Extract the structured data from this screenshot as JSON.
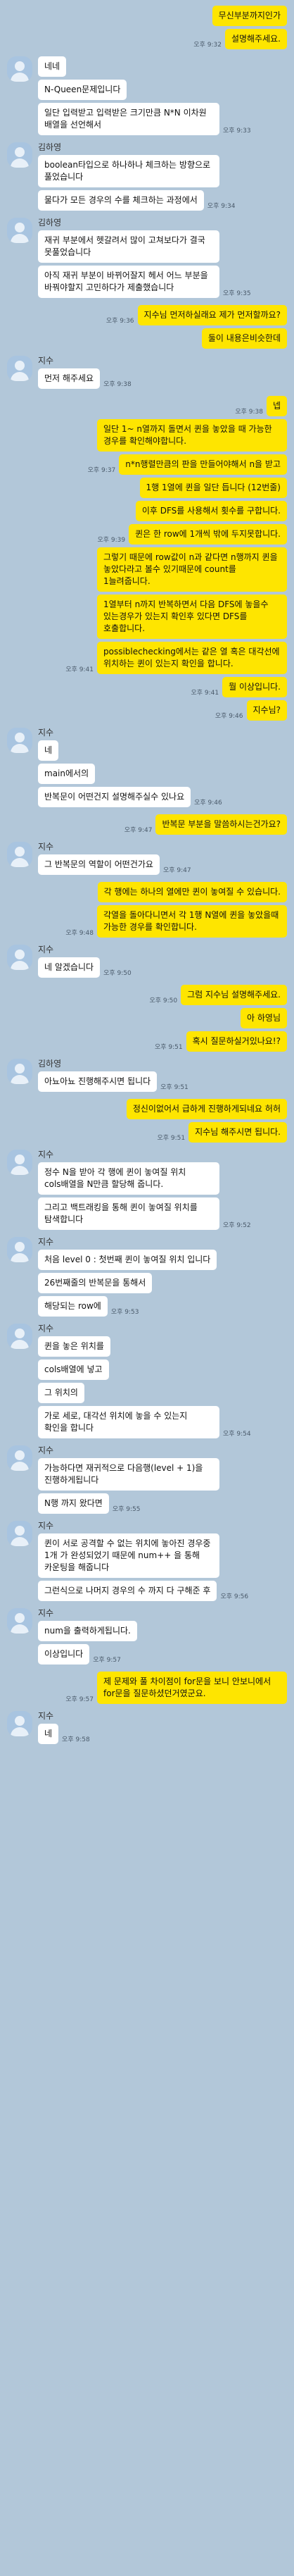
{
  "messages": [
    {
      "side": "me",
      "bubbles": [
        {
          "text": "무신부분까지인가"
        },
        {
          "text": "설명해주세요.",
          "time": "오후 9:32"
        }
      ]
    },
    {
      "side": "other",
      "sender": "",
      "bubbles": [
        {
          "text": "네네"
        },
        {
          "text": "N-Queen문제입니다"
        },
        {
          "text": "일단 입력받고 입력받은 크기만큼 N*N 이차원 배열을 선언해서",
          "time": "오후 9:33"
        }
      ]
    },
    {
      "side": "other",
      "sender": "김하영",
      "bubbles": [
        {
          "text": "boolean타입으로 하나하나 체크하는 방향으로 풀었습니다"
        },
        {
          "text": "물다가 모든 경우의 수를 체크하는 과정에서",
          "time": "오후 9:34"
        }
      ]
    },
    {
      "side": "other",
      "sender": "김하영",
      "bubbles": [
        {
          "text": "재귀 부분에서 헷갈려서 많이 고쳐보다가 결국 못풀었습니다"
        },
        {
          "text": "아직 재귀 부분이 바뀌어잘지 헤서 어느 부분을 바꿔야할지 고민하다가 제출했습니다",
          "time": "오후 9:35"
        }
      ]
    },
    {
      "side": "me",
      "bubbles": [
        {
          "text": "지수님 먼저하실래요 제가 먼저할까요?",
          "time": "오후 9:36"
        },
        {
          "text": "둘이 내용은비슷한데"
        }
      ]
    },
    {
      "side": "other",
      "sender": "지수",
      "bubbles": [
        {
          "text": "먼저 해주세요",
          "time": "오후 9:38"
        }
      ]
    },
    {
      "side": "me",
      "bubbles": [
        {
          "text": "넵",
          "time": "오후 9:38"
        },
        {
          "text": "일단 1~ n열까지 돌면서 퀸을 놓았을 때 가능한 경우를 확인해야합니다."
        },
        {
          "text": "n*n행렬만큼의 판을 만들어야해서 n을 받고",
          "time": "오후 9:37"
        },
        {
          "text": "1행 1열에 퀸을 일단 듭니다 (12번줄)"
        },
        {
          "text": "이후 DFS를 사용해서 횟수를 구합니다."
        },
        {
          "text": "퀸은 한 row에 1개씩 밖에 두지못합니다.",
          "time": "오후 9:39"
        },
        {
          "text": "그렇기 때문에 row값이 n과 같다면 n행까지 퀸을 놓았다라고 볼수 있기때문에 count를 1늘려줍니다."
        },
        {
          "text": "1열부터 n까지 반복하면서 다음 DFS에 놓을수 있는경우가 있는지 확인후 있다면 DFS를 호출합니다."
        },
        {
          "text": "possiblechecking에서는 같은 열 혹은 대각선에 위치하는 퀸이 있는지 확인을 합니다.",
          "time": "오후 9:41"
        },
        {
          "text": "뭘 이상입니다.",
          "time": "오후 9:41"
        },
        {
          "text": "지수님?",
          "time": "오후 9:46"
        }
      ]
    },
    {
      "side": "other",
      "sender": "지수",
      "bubbles": [
        {
          "text": "네"
        },
        {
          "text": "main에서의"
        },
        {
          "text": "반복문이 어떤건지 설명해주실수 있나요",
          "time": "오후 9:46"
        }
      ]
    },
    {
      "side": "me",
      "bubbles": [
        {
          "text": "반복문 부분을 말씀하시는건가요?",
          "time": "오후 9:47"
        }
      ]
    },
    {
      "side": "other",
      "sender": "지수",
      "bubbles": [
        {
          "text": "그 반복문의 역할이 어떤건가요",
          "time": "오후 9:47"
        }
      ]
    },
    {
      "side": "me",
      "bubbles": [
        {
          "text": "각 행에는 하나의 열에만 퀸이 놓여질 수 있습니다."
        },
        {
          "text": "각열을 돌아다니면서 각 1행 N열에 퀸을 놓았을때 가능한 경우를 확인합니다.",
          "time": "오후 9:48"
        }
      ]
    },
    {
      "side": "other",
      "sender": "지수",
      "bubbles": [
        {
          "text": "네 알겠습니다",
          "time": "오후 9:50"
        }
      ]
    },
    {
      "side": "me",
      "bubbles": [
        {
          "text": "그럼 지수님 설명해주세요.",
          "time": "오후 9:50"
        },
        {
          "text": "아 하영님"
        },
        {
          "text": "혹시 질문하실거있나요!?",
          "time": "오후 9:51"
        }
      ]
    },
    {
      "side": "other",
      "sender": "김하영",
      "bubbles": [
        {
          "text": "아뇨아뇨 진행해주시면 됩니다",
          "time": "오후 9:51"
        }
      ]
    },
    {
      "side": "me",
      "bubbles": [
        {
          "text": "정신이없어서 급하게 진행하게되네요 허허"
        },
        {
          "text": "지수님 해주시면 됩니다.",
          "time": "오후 9:51"
        }
      ]
    },
    {
      "side": "other",
      "sender": "지수",
      "bubbles": [
        {
          "text": "정수 N을 받아 각 행에 퀸이 놓여질 위치 cols배열을 N만큼 할당해 줍니다."
        },
        {
          "text": "그리고 백트래킹을 통해 퀸이 놓여질 위치를 탐색합니다",
          "time": "오후 9:52"
        }
      ]
    },
    {
      "side": "other",
      "sender": "지수",
      "bubbles": [
        {
          "text": "처음 level 0 : 첫번째 퀸이 놓여질 위치 입니다"
        },
        {
          "text": "26번째줄의 반복문을 통해서"
        },
        {
          "text": "해당되는 row에",
          "time": "오후 9:53"
        }
      ]
    },
    {
      "side": "other",
      "sender": "지수",
      "bubbles": [
        {
          "text": "퀸을 놓은 위치를"
        },
        {
          "text": "cols배열에 넣고"
        },
        {
          "text": "그 위치의"
        },
        {
          "text": "가로 세로, 대각선 위치에 놓을 수 있는지 확인을 합니다",
          "time": "오후 9:54"
        }
      ]
    },
    {
      "side": "other",
      "sender": "지수",
      "bubbles": [
        {
          "text": "가능하다면 재귀적으로 다음행(level + 1)을 진행하게됩니다"
        },
        {
          "text": "N행 까지 왔다면",
          "time": "오후 9:55"
        }
      ]
    },
    {
      "side": "other",
      "sender": "지수",
      "bubbles": [
        {
          "text": "퀸이 서로 공격할 수 없는 위치에 놓아진 경우중 1개 가 완성되었기 때문에 num++ 을 통해 카운팅을 해줍니다"
        },
        {
          "text": "그런식으로 나머지 경우의 수 까지 다 구해준 후",
          "time": "오후 9:56"
        }
      ]
    },
    {
      "side": "other",
      "sender": "지수",
      "bubbles": [
        {
          "text": "num을 출력하게됩니다."
        },
        {
          "text": "이상입니다",
          "time": "오후 9:57"
        }
      ]
    },
    {
      "side": "me",
      "bubbles": [
        {
          "text": "제 문제와 풀 차이점이 for문을 보니 안보니에서 for문을 질문하셨던거였군요.",
          "time": "오후 9:57"
        }
      ]
    },
    {
      "side": "other",
      "sender": "지수",
      "bubbles": [
        {
          "text": "네",
          "time": "오후 9:58"
        }
      ]
    }
  ]
}
